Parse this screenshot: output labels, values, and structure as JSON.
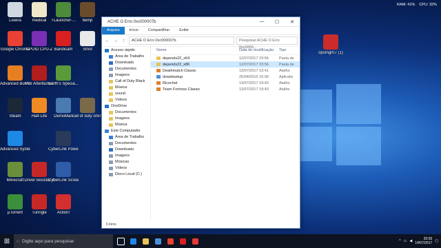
{
  "desktop_icons": [
    {
      "label": "Lixeira",
      "color": "#cfd8e0"
    },
    {
      "label": "medical",
      "color": "#eee8c8"
    },
    {
      "label": "TLauncher-...",
      "color": "#4d8a3a"
    },
    {
      "label": "tlemp",
      "color": "#6a4c2a"
    },
    {
      "label": "Google Chrome",
      "color": "#e94235"
    },
    {
      "label": "CPUID CPU-Z",
      "color": "#7a2fb5"
    },
    {
      "label": "Bandicam",
      "color": "#d82020"
    },
    {
      "label": "Smol",
      "color": "#e9e9e9"
    },
    {
      "label": "Advanced Burning S...",
      "color": "#e67e22"
    },
    {
      "label": "MSI Afterburner",
      "color": "#b01e1e"
    },
    {
      "label": "Earth's Specia...",
      "color": "#5a9a3a"
    },
    {
      "label": "Steam",
      "color": "#1b2838"
    },
    {
      "label": "Half-Life",
      "color": "#f08a24"
    },
    {
      "label": "DemoMan",
      "color": "#4a7ab0"
    },
    {
      "label": "call of duty online",
      "color": "#7a6a4a"
    },
    {
      "label": "Advanced SystemCa...",
      "color": "#1e88e5"
    },
    {
      "label": "CyberLink PowerDirec...",
      "color": "#2a3a5a"
    },
    {
      "label": "Minecraft",
      "color": "#6b8e3a"
    },
    {
      "label": "Driver Booster 4",
      "color": "#c62828"
    },
    {
      "label": "CyberLink Screen ...",
      "color": "#2e5ca8"
    },
    {
      "label": "µTorrent",
      "color": "#3a8f3a"
    },
    {
      "label": "Tunngle",
      "color": "#c62828"
    },
    {
      "label": "Action!",
      "color": "#d32f2f"
    },
    {
      "label": "opsmgr07 (1)",
      "color": "#cc2b2b"
    }
  ],
  "explorer": {
    "title": "ACHE O Erro 0xc000007b",
    "ribbon_tabs": [
      "Arquivo",
      "Início",
      "Compartilhar",
      "Exibir"
    ],
    "path": "ACHE O Erro 0xc000007b",
    "search_placeholder": "Pesquisar ACHE O Erro 0xc0000...",
    "nav_items": [
      {
        "label": "Acesso rápido",
        "color": "#1979ca"
      },
      {
        "label": "Área de Trabalho",
        "color": "#3a7fd5"
      },
      {
        "label": "Downloads",
        "color": "#2e6fc4"
      },
      {
        "label": "Documentos",
        "color": "#8a9bb3"
      },
      {
        "label": "Imagens",
        "color": "#8a9bb3"
      },
      {
        "label": "Call of Duty Black",
        "color": "#e8c35a"
      },
      {
        "label": "Música",
        "color": "#e8c35a"
      },
      {
        "label": "sound",
        "color": "#e8c35a"
      },
      {
        "label": "Vídeos",
        "color": "#e8c35a"
      },
      {
        "label": "OneDrive",
        "color": "#2a6ec9"
      },
      {
        "label": "Documentos",
        "color": "#e8c35a"
      },
      {
        "label": "Imagens",
        "color": "#e8c35a"
      },
      {
        "label": "Música",
        "color": "#e8c35a"
      },
      {
        "label": "Este Computador",
        "color": "#3a7fd5"
      },
      {
        "label": "Área de Trabalho",
        "color": "#3a7fd5"
      },
      {
        "label": "Documentos",
        "color": "#8a9bb3"
      },
      {
        "label": "Downloads",
        "color": "#2e6fc4"
      },
      {
        "label": "Imagens",
        "color": "#8a9bb3"
      },
      {
        "label": "Músicas",
        "color": "#8a9bb3"
      },
      {
        "label": "Vídeos",
        "color": "#8a9bb3"
      },
      {
        "label": "Disco Local (C:)",
        "color": "#8a9bb3"
      }
    ],
    "columns": {
      "name": "Nome",
      "date": "Data de modificação",
      "type": "Tipo"
    },
    "files": [
      {
        "name": "depends22_x64",
        "date": "12/07/2017 23:56",
        "type": "Pasta de",
        "selected": false,
        "color": "#e8c35a"
      },
      {
        "name": "depends22_x86",
        "date": "12/07/2017 23:56",
        "type": "Pasta de",
        "selected": true,
        "color": "#e8c35a"
      },
      {
        "name": "Deathmatch Classic",
        "date": "13/07/2017 19:41",
        "type": "Atalho",
        "selected": false,
        "color": "#d9822b"
      },
      {
        "name": "dxwebsetup",
        "date": "25/04/2015 15:00",
        "type": "Aplicativ",
        "selected": false,
        "color": "#4a90d9"
      },
      {
        "name": "Ricochet",
        "date": "13/07/2017 19:43",
        "type": "Atalho",
        "selected": false,
        "color": "#d9822b"
      },
      {
        "name": "Team Fortress Classic",
        "date": "13/07/2017 19:43",
        "type": "Atalho",
        "selected": false,
        "color": "#d9822b"
      }
    ],
    "status": "6 itens"
  },
  "taskbar": {
    "search_placeholder": "Digite aqui para pesquisar",
    "apps": [
      {
        "name": "task-view",
        "color": "#ffffff"
      },
      {
        "name": "edge",
        "color": "#1e88e5"
      },
      {
        "name": "file-explorer",
        "color": "#e8c35a"
      },
      {
        "name": "store",
        "color": "#4a90d9"
      },
      {
        "name": "chrome",
        "color": "#e94235"
      },
      {
        "name": "bandicam",
        "color": "#d82020"
      },
      {
        "name": "record",
        "color": "#e53935"
      }
    ],
    "time": "20:55",
    "date": "14/07/2017"
  },
  "meter": {
    "ram": "RAM: 41%",
    "cpu": "CPU: 32%"
  }
}
